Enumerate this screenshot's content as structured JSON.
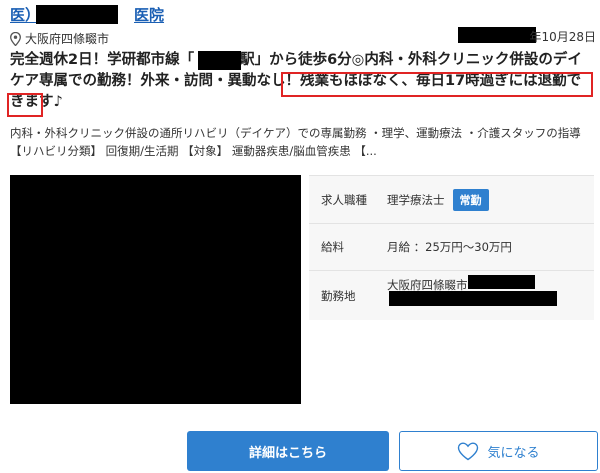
{
  "header": {
    "clinic_prefix": "医）",
    "clinic_suffix": "医院",
    "location": "大阪府四條畷市",
    "date": "年10月28日"
  },
  "title": {
    "part1": "完全週休2日！学研都市線「",
    "part2": "駅」から徒歩6分◎内科・外科クリニック併設のデイケア専属での勤務！外来・訪問・異動なし！",
    "highlight_line1": "残業もほぼなく、毎日17時過ぎには退勤できま",
    "highlight_line2": "す♪"
  },
  "description": "内科・外科クリニック併設の通所リハビリ（デイケア）での専属勤務 ・理学、運動療法 ・介護スタッフの指導 【リハビリ分類】 回復期/生活期 【対象】 運動器疾患/脳血管疾患 【...",
  "info": {
    "rows": [
      {
        "label": "求人職種",
        "value": "理学療法士",
        "badge": "常勤"
      },
      {
        "label": "給料",
        "value": "月給 ：25万円〜30万円"
      },
      {
        "label": "勤務地",
        "value": "大阪府四條畷市"
      }
    ]
  },
  "buttons": {
    "details": "詳細はこちら",
    "favorite": "気になる"
  },
  "icons": {
    "location": "map-pin-icon",
    "favorite": "heart-icon"
  },
  "colors": {
    "accent": "#2f80cf",
    "highlight_border": "#e02424",
    "link": "#1a5fb4"
  }
}
